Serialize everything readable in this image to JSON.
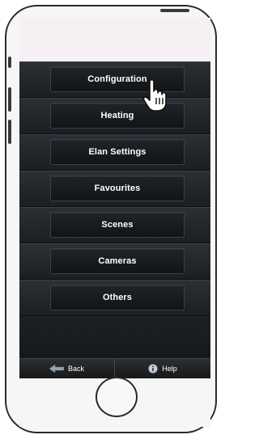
{
  "menu": {
    "items": [
      {
        "label": "Configuration"
      },
      {
        "label": "Heating"
      },
      {
        "label": "Elan Settings"
      },
      {
        "label": "Favourites"
      },
      {
        "label": "Scenes"
      },
      {
        "label": "Cameras"
      },
      {
        "label": "Others"
      }
    ]
  },
  "toolbar": {
    "back_label": "Back",
    "back_icon": "back-arrow-icon",
    "help_label": "Help",
    "help_icon": "info-icon"
  },
  "cursor": {
    "icon": "hand-pointer-icon"
  },
  "colors": {
    "screen_bg": "#1f2327",
    "button_text": "#ffffff",
    "phone_frame": "#2a2a2a"
  }
}
